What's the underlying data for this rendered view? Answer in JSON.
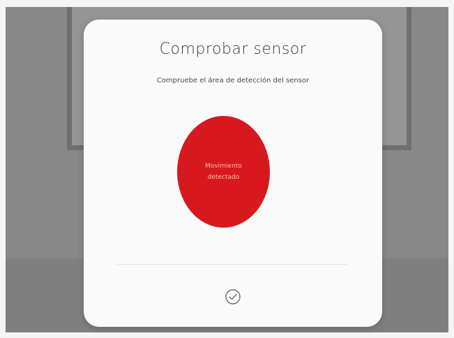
{
  "dialog": {
    "title": "Comprobar sensor",
    "subtitle": "Compruebe el área de detección del sensor",
    "status_text": "Movimiento\ndetectado",
    "confirm_icon": "check-circle-icon"
  },
  "colors": {
    "status_red": "#d7191f",
    "status_text": "#f2c9a0",
    "modal_bg": "#fafafa",
    "backdrop": "#888888"
  }
}
